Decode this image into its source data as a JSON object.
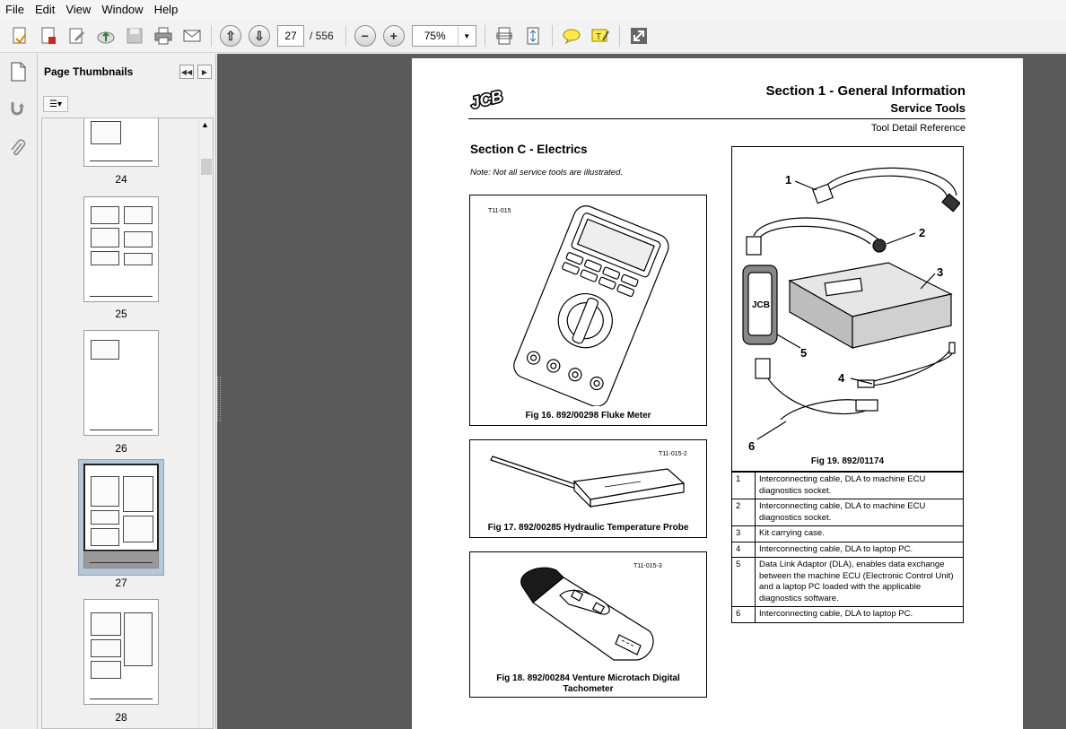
{
  "menu": [
    "File",
    "Edit",
    "View",
    "Window",
    "Help"
  ],
  "toolbar": {
    "page_current": "27",
    "page_total": "/ 556",
    "zoom": "75%"
  },
  "panel": {
    "title": "Page Thumbnails",
    "thumbnails": [
      {
        "label": "24"
      },
      {
        "label": "25"
      },
      {
        "label": "26"
      },
      {
        "label": "27",
        "selected": true
      },
      {
        "label": "28"
      }
    ]
  },
  "document": {
    "logo": "JCB",
    "section_title": "Section 1 - General Information",
    "subtitle": "Service Tools",
    "detail": "Tool Detail Reference",
    "heading": "Section C - Electrics",
    "note": "Note: Not all service tools are illustrated.",
    "figures": [
      {
        "code": "T11-015",
        "caption": "Fig 16. 892/00298 Fluke Meter"
      },
      {
        "code": "T11-015-2",
        "caption": "Fig 17. 892/00285 Hydraulic Temperature Probe"
      },
      {
        "code": "T11-015-3",
        "caption_line1": "Fig 18. 892/00284 Venture Microtach Digital",
        "caption_line2": "Tachometer"
      },
      {
        "caption": "Fig 19. 892/01174",
        "callouts": [
          "1",
          "2",
          "3",
          "4",
          "5",
          "6"
        ]
      }
    ],
    "legend": [
      {
        "num": "1",
        "text": "Interconnecting cable, DLA to machine ECU diagnostics socket."
      },
      {
        "num": "2",
        "text": "Interconnecting cable, DLA to machine ECU diagnostics socket."
      },
      {
        "num": "3",
        "text": "Kit carrying case."
      },
      {
        "num": "4",
        "text": "Interconnecting cable, DLA to laptop PC."
      },
      {
        "num": "5",
        "text": "Data Link Adaptor (DLA), enables data exchange between the machine ECU (Electronic Control Unit) and a laptop PC loaded with the applicable diagnostics software."
      },
      {
        "num": "6",
        "text": "Interconnecting cable, DLA to laptop PC."
      }
    ]
  }
}
